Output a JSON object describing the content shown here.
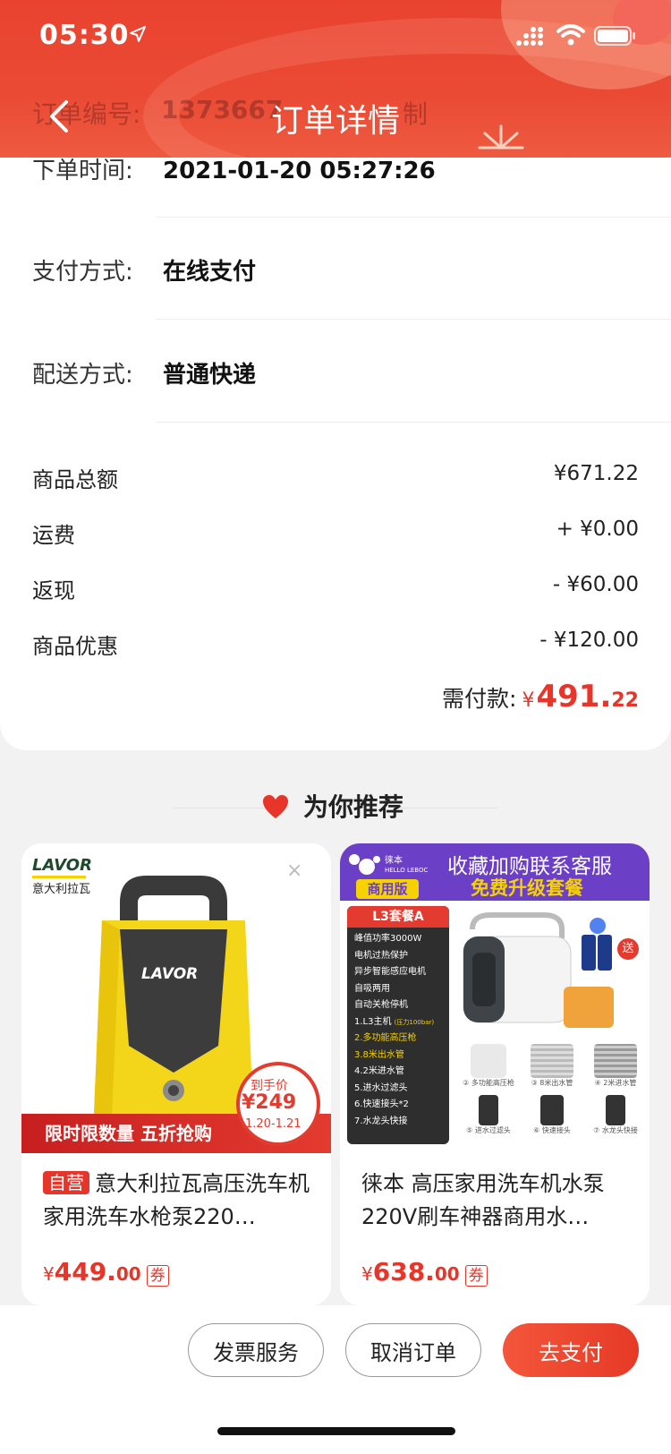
{
  "status_bar": {
    "time": "05:30"
  },
  "header": {
    "title": "订单详情",
    "under_text_1": "订单编号:",
    "under_text_2": "1373667",
    "under_text_3": "制"
  },
  "order_info": {
    "order_time_label": "下单时间:",
    "order_time_value": "2021-01-20 05:27:26",
    "payment_label": "支付方式:",
    "payment_value": "在线支付",
    "delivery_label": "配送方式:",
    "delivery_value": "普通快递"
  },
  "price_summary": {
    "rows": [
      {
        "label": "商品总额",
        "value": "¥671.22"
      },
      {
        "label": "运费",
        "value": "+ ¥0.00"
      },
      {
        "label": "返现",
        "value": "- ¥60.00"
      },
      {
        "label": "商品优惠",
        "value": "- ¥120.00"
      }
    ],
    "need_pay_label": "需付款:",
    "need_pay_symbol": "¥",
    "need_pay_int": "491.",
    "need_pay_dec": "22"
  },
  "recommend": {
    "title": "为你推荐",
    "products": [
      {
        "tag": "自营",
        "name": "意大利拉瓦高压洗车机家用洗车水枪泵220…",
        "price_symbol": "¥",
        "price_int": "449.",
        "price_dec": "00",
        "coupon": "券",
        "img_brand": "LAVOR",
        "img_brand_cn": "意大利拉瓦",
        "img_banner": "限时限数量 五折抢购",
        "img_badge_label": "到手价",
        "img_badge_price": "¥249",
        "img_badge_date": "1.20-1.21",
        "img_body_logo": "LAVOR"
      },
      {
        "tag": "",
        "name": "徕本 高压家用洗车机水泵220V刷车神器商用水…",
        "price_symbol": "¥",
        "price_int": "638.",
        "price_dec": "00",
        "coupon": "券",
        "img_brand_cn": "徕本",
        "img_brand_en": "HELLO LEBOC",
        "img_edition": "商用版",
        "img_headline_1": "收藏加购联系客服",
        "img_headline_2": "免费升级套餐",
        "img_pkg_title": "L3套餐A",
        "img_pkg_items": [
          "峰值功率3000W",
          "电机过热保护",
          "异步智能感应电机",
          "自吸两用",
          "自动关枪停机",
          "1.L3主机",
          "2.多功能高压枪",
          "3.8米出水管",
          "4.2米进水管",
          "5.进水过滤头",
          "6.快速接头*2",
          "7.水龙头快接"
        ],
        "img_pkg_note": "(压力100bar)",
        "img_gift": "送",
        "img_captions": [
          "② 多功能高压枪",
          "③ 8米出水管",
          "④ 2米进水管",
          "⑤ 进水过滤头",
          "⑥ 快速接头",
          "⑦ 水龙头快接"
        ]
      }
    ]
  },
  "actions": {
    "invoice": "发票服务",
    "cancel": "取消订单",
    "pay": "去支付"
  },
  "colors": {
    "accent": "#e8352a",
    "header": "#e9432f"
  }
}
